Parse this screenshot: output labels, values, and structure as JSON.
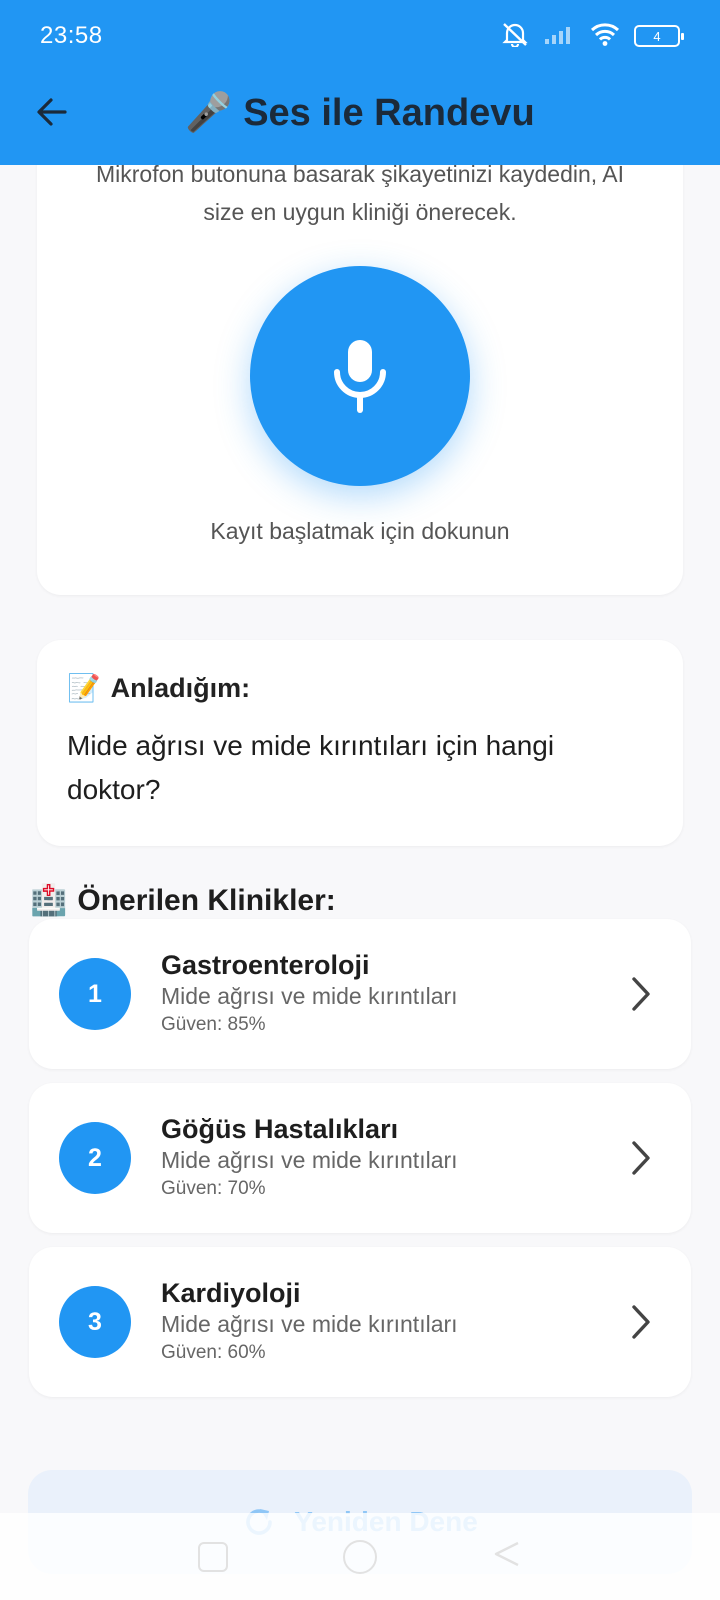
{
  "status_bar": {
    "time": "23:58",
    "battery": "4"
  },
  "appbar": {
    "title": "🎤 Ses ile Randevu"
  },
  "record_card": {
    "description": "Mikrofon butonuna basarak şikayetinizi kaydedin, AI size en uygun kliniği önerecek.",
    "hint": "Kayıt başlatmak için dokunun"
  },
  "understood": {
    "emoji": "📝",
    "title": "Anladığım:",
    "text": "Mide ağrısı ve mide kırıntıları için hangi doktor?"
  },
  "clinics_section": {
    "emoji": "🏥",
    "title": "Önerilen Klinikler:"
  },
  "clinics": [
    {
      "rank": "1",
      "name": "Gastroenteroloji",
      "reason": "Mide ağrısı ve mide kırıntıları",
      "confidence": "Güven: 85%"
    },
    {
      "rank": "2",
      "name": "Göğüs Hastalıkları",
      "reason": "Mide ağrısı ve mide kırıntıları",
      "confidence": "Güven: 70%"
    },
    {
      "rank": "3",
      "name": "Kardiyoloji",
      "reason": "Mide ağrısı ve mide kırıntıları",
      "confidence": "Güven: 60%"
    }
  ],
  "retry_button": {
    "label": "Yeniden Dene"
  },
  "colors": {
    "primary": "#2196f3",
    "background": "#f8f8fa",
    "card": "#ffffff"
  },
  "icons": {
    "back": "arrow-left-icon",
    "mic": "microphone-icon",
    "chevron": "chevron-right-icon",
    "retry": "refresh-icon"
  }
}
